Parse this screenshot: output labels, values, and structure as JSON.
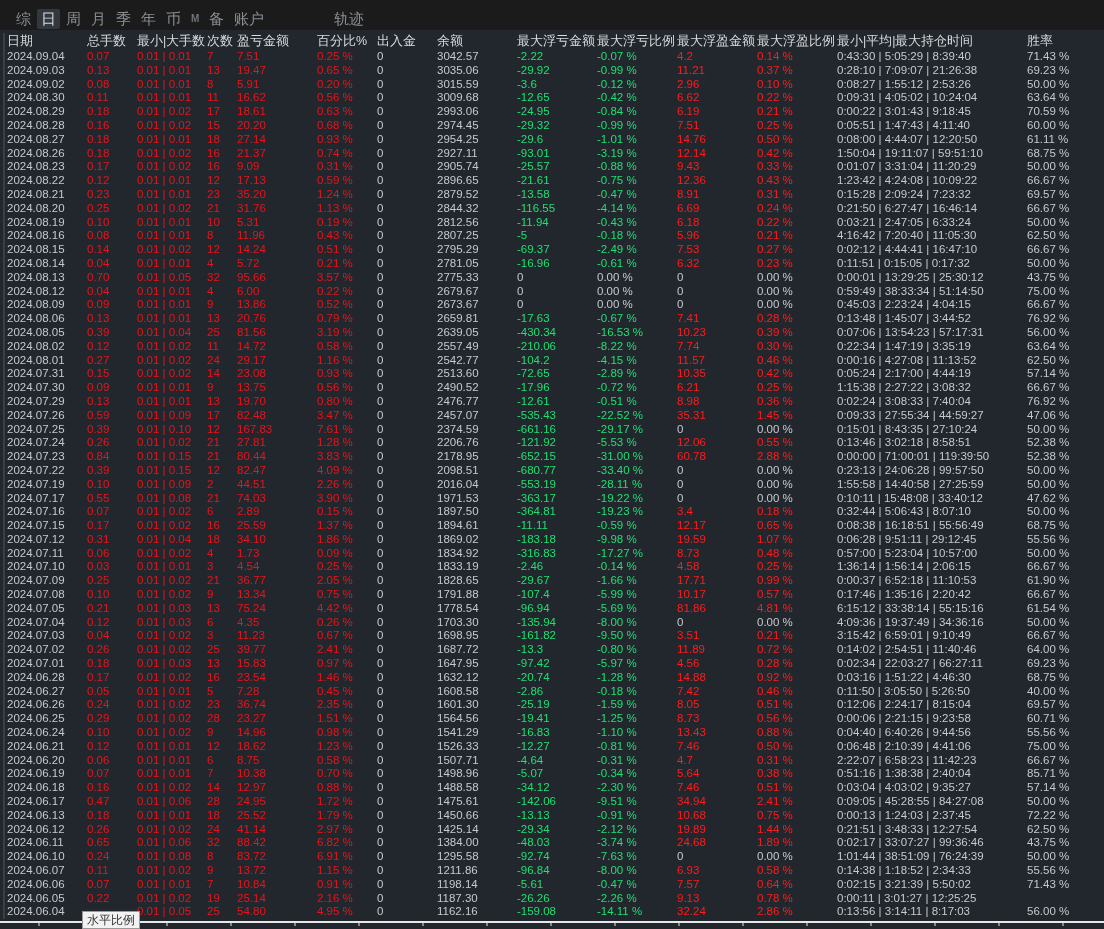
{
  "tabs": [
    {
      "label": "综",
      "selected": false
    },
    {
      "label": "日",
      "selected": true
    },
    {
      "label": "周",
      "selected": false
    },
    {
      "label": "月",
      "selected": false
    },
    {
      "label": "季",
      "selected": false
    },
    {
      "label": "年",
      "selected": false
    },
    {
      "label": "币",
      "selected": false
    },
    {
      "label": "M",
      "selected": false
    },
    {
      "label": "备",
      "selected": false
    },
    {
      "label": "账户",
      "selected": false
    },
    {
      "label": "轨迹",
      "selected": false
    }
  ],
  "table": {
    "columns": [
      {
        "label": "日期",
        "kind": "plain"
      },
      {
        "label": "总手数",
        "kind": "gain"
      },
      {
        "label": "最小|大手数",
        "kind": "gain"
      },
      {
        "label": "次数",
        "kind": "gain"
      },
      {
        "label": "盈亏金额",
        "kind": "gain"
      },
      {
        "label": "百分比%",
        "kind": "gain"
      },
      {
        "label": "出入金",
        "kind": "plain"
      },
      {
        "label": "余额",
        "kind": "plain"
      },
      {
        "label": "最大浮亏金额",
        "kind": "drawdown"
      },
      {
        "label": "最大浮亏比例",
        "kind": "drawdown"
      },
      {
        "label": "最大浮盈金额",
        "kind": "runup"
      },
      {
        "label": "最大浮盈比例",
        "kind": "runup"
      },
      {
        "label": "最小|平均|最大持仓时间",
        "kind": "plain"
      },
      {
        "label": "胜率",
        "kind": "plain"
      }
    ],
    "rows": [
      {
        "cells": [
          "2024.09.04",
          "0.07",
          "0.01 | 0.01",
          "7",
          "7.51",
          "0.25 %",
          "0",
          "3042.57",
          "-2.22",
          "-0.07 %",
          "4.2",
          "0.14 %",
          "0:43:30 | 5:05:29 | 8:39:40",
          "71.43 %"
        ],
        "loss_flat": false,
        "profit_flat": false
      },
      {
        "cells": [
          "2024.09.03",
          "0.13",
          "0.01 | 0.01",
          "13",
          "19.47",
          "0.65 %",
          "0",
          "3035.06",
          "-29.92",
          "-0.99 %",
          "11.21",
          "0.37 %",
          "0:28:10 | 7:09:07 | 21:26:38",
          "69.23 %"
        ],
        "loss_flat": false,
        "profit_flat": false
      },
      {
        "cells": [
          "2024.09.02",
          "0.08",
          "0.01 | 0.01",
          "8",
          "5.91",
          "0.20 %",
          "0",
          "3015.59",
          "-3.6",
          "-0.12 %",
          "2.96",
          "0.10 %",
          "0:08:27 | 1:55:12 | 2:53:26",
          "50.00 %"
        ],
        "loss_flat": false,
        "profit_flat": false
      },
      {
        "cells": [
          "2024.08.30",
          "0.11",
          "0.01 | 0.01",
          "11",
          "16.62",
          "0.56 %",
          "0",
          "3009.68",
          "-12.65",
          "-0.42 %",
          "6.62",
          "0.22 %",
          "0:09:31 | 4:05:02 | 10:24:04",
          "63.64 %"
        ],
        "loss_flat": false,
        "profit_flat": false
      },
      {
        "cells": [
          "2024.08.29",
          "0.18",
          "0.01 | 0.02",
          "17",
          "18.61",
          "0.63 %",
          "0",
          "2993.06",
          "-24.95",
          "-0.84 %",
          "6.19",
          "0.21 %",
          "0:00:22 | 3:01:43 | 9:18:45",
          "70.59 %"
        ],
        "loss_flat": false,
        "profit_flat": false
      },
      {
        "cells": [
          "2024.08.28",
          "0.16",
          "0.01 | 0.02",
          "15",
          "20.20",
          "0.68 %",
          "0",
          "2974.45",
          "-29.32",
          "-0.99 %",
          "7.51",
          "0.25 %",
          "0:05:51 | 1:47:43 | 4:11:40",
          "60.00 %"
        ],
        "loss_flat": false,
        "profit_flat": false
      },
      {
        "cells": [
          "2024.08.27",
          "0.18",
          "0.01 | 0.01",
          "18",
          "27.14",
          "0.93 %",
          "0",
          "2954.25",
          "-29.6",
          "-1.01 %",
          "14.76",
          "0.50 %",
          "0:08:00 | 4:44:07 | 12:20:50",
          "61.11 %"
        ],
        "loss_flat": false,
        "profit_flat": false
      },
      {
        "cells": [
          "2024.08.26",
          "0.18",
          "0.01 | 0.02",
          "16",
          "21.37",
          "0.74 %",
          "0",
          "2927.11",
          "-93.01",
          "-3.19 %",
          "12.14",
          "0.42 %",
          "1:50:04 | 19:11:07 | 59:51:10",
          "68.75 %"
        ],
        "loss_flat": false,
        "profit_flat": false
      },
      {
        "cells": [
          "2024.08.23",
          "0.17",
          "0.01 | 0.02",
          "16",
          "9.09",
          "0.31 %",
          "0",
          "2905.74",
          "-25.57",
          "-0.88 %",
          "9.43",
          "0.33 %",
          "0:01:07 | 3:31:04 | 11:20:29",
          "50.00 %"
        ],
        "loss_flat": false,
        "profit_flat": false
      },
      {
        "cells": [
          "2024.08.22",
          "0.12",
          "0.01 | 0.01",
          "12",
          "17.13",
          "0.59 %",
          "0",
          "2896.65",
          "-21.61",
          "-0.75 %",
          "12.36",
          "0.43 %",
          "1:23:42 | 4:24:08 | 10:09:22",
          "66.67 %"
        ],
        "loss_flat": false,
        "profit_flat": false
      },
      {
        "cells": [
          "2024.08.21",
          "0.23",
          "0.01 | 0.01",
          "23",
          "35.20",
          "1.24 %",
          "0",
          "2879.52",
          "-13.58",
          "-0.47 %",
          "8.91",
          "0.31 %",
          "0:15:28 | 2:09:24 | 7:23:32",
          "69.57 %"
        ],
        "loss_flat": false,
        "profit_flat": false
      },
      {
        "cells": [
          "2024.08.20",
          "0.25",
          "0.01 | 0.02",
          "21",
          "31.76",
          "1.13 %",
          "0",
          "2844.32",
          "-116.55",
          "-4.14 %",
          "6.69",
          "0.24 %",
          "0:21:50 | 6:27:47 | 16:46:14",
          "66.67 %"
        ],
        "loss_flat": false,
        "profit_flat": false
      },
      {
        "cells": [
          "2024.08.19",
          "0.10",
          "0.01 | 0.01",
          "10",
          "5.31",
          "0.19 %",
          "0",
          "2812.56",
          "-11.94",
          "-0.43 %",
          "6.18",
          "0.22 %",
          "0:03:21 | 2:47:05 | 6:33:24",
          "50.00 %"
        ],
        "loss_flat": false,
        "profit_flat": false
      },
      {
        "cells": [
          "2024.08.16",
          "0.08",
          "0.01 | 0.01",
          "8",
          "11.96",
          "0.43 %",
          "0",
          "2807.25",
          "-5",
          "-0.18 %",
          "5.96",
          "0.21 %",
          "4:16:42 | 7:20:40 | 11:05:30",
          "62.50 %"
        ],
        "loss_flat": false,
        "profit_flat": false
      },
      {
        "cells": [
          "2024.08.15",
          "0.14",
          "0.01 | 0.02",
          "12",
          "14.24",
          "0.51 %",
          "0",
          "2795.29",
          "-69.37",
          "-2.49 %",
          "7.53",
          "0.27 %",
          "0:02:12 | 4:44:41 | 16:47:10",
          "66.67 %"
        ],
        "loss_flat": false,
        "profit_flat": false
      },
      {
        "cells": [
          "2024.08.14",
          "0.04",
          "0.01 | 0.01",
          "4",
          "5.72",
          "0.21 %",
          "0",
          "2781.05",
          "-16.96",
          "-0.61 %",
          "6.32",
          "0.23 %",
          "0:11:51 | 0:15:05 | 0:17:32",
          "50.00 %"
        ],
        "loss_flat": false,
        "profit_flat": false
      },
      {
        "cells": [
          "2024.08.13",
          "0.70",
          "0.01 | 0.05",
          "32",
          "95.66",
          "3.57 %",
          "0",
          "2775.33",
          "0",
          "0.00 %",
          "0",
          "0.00 %",
          "0:00:01 | 13:29:25 | 25:30:12",
          "43.75 %"
        ],
        "loss_flat": true,
        "profit_flat": true
      },
      {
        "cells": [
          "2024.08.12",
          "0.04",
          "0.01 | 0.01",
          "4",
          "6.00",
          "0.22 %",
          "0",
          "2679.67",
          "0",
          "0.00 %",
          "0",
          "0.00 %",
          "0:59:49 | 38:33:34 | 51:14:50",
          "75.00 %"
        ],
        "loss_flat": true,
        "profit_flat": true
      },
      {
        "cells": [
          "2024.08.09",
          "0.09",
          "0.01 | 0.01",
          "9",
          "13.86",
          "0.52 %",
          "0",
          "2673.67",
          "0",
          "0.00 %",
          "0",
          "0.00 %",
          "0:45:03 | 2:23:24 | 4:04:15",
          "66.67 %"
        ],
        "loss_flat": true,
        "profit_flat": true
      },
      {
        "cells": [
          "2024.08.06",
          "0.13",
          "0.01 | 0.01",
          "13",
          "20.76",
          "0.79 %",
          "0",
          "2659.81",
          "-17.63",
          "-0.67 %",
          "7.41",
          "0.28 %",
          "0:13:48 | 1:45:07 | 3:44:52",
          "76.92 %"
        ],
        "loss_flat": false,
        "profit_flat": false
      },
      {
        "cells": [
          "2024.08.05",
          "0.39",
          "0.01 | 0.04",
          "25",
          "81.56",
          "3.19 %",
          "0",
          "2639.05",
          "-430.34",
          "-16.53 %",
          "10.23",
          "0.39 %",
          "0:07:06 | 13:54:23 | 57:17:31",
          "56.00 %"
        ],
        "loss_flat": false,
        "profit_flat": false
      },
      {
        "cells": [
          "2024.08.02",
          "0.12",
          "0.01 | 0.02",
          "11",
          "14.72",
          "0.58 %",
          "0",
          "2557.49",
          "-210.06",
          "-8.22 %",
          "7.74",
          "0.30 %",
          "0:22:34 | 1:47:19 | 3:35:19",
          "63.64 %"
        ],
        "loss_flat": false,
        "profit_flat": false
      },
      {
        "cells": [
          "2024.08.01",
          "0.27",
          "0.01 | 0.02",
          "24",
          "29.17",
          "1.16 %",
          "0",
          "2542.77",
          "-104.2",
          "-4.15 %",
          "11.57",
          "0.46 %",
          "0:00:16 | 4:27:08 | 11:13:52",
          "62.50 %"
        ],
        "loss_flat": false,
        "profit_flat": false
      },
      {
        "cells": [
          "2024.07.31",
          "0.15",
          "0.01 | 0.02",
          "14",
          "23.08",
          "0.93 %",
          "0",
          "2513.60",
          "-72.65",
          "-2.89 %",
          "10.35",
          "0.42 %",
          "0:05:24 | 2:17:00 | 4:44:19",
          "57.14 %"
        ],
        "loss_flat": false,
        "profit_flat": false
      },
      {
        "cells": [
          "2024.07.30",
          "0.09",
          "0.01 | 0.01",
          "9",
          "13.75",
          "0.56 %",
          "0",
          "2490.52",
          "-17.96",
          "-0.72 %",
          "6.21",
          "0.25 %",
          "1:15:38 | 2:27:22 | 3:08:32",
          "66.67 %"
        ],
        "loss_flat": false,
        "profit_flat": false
      },
      {
        "cells": [
          "2024.07.29",
          "0.13",
          "0.01 | 0.01",
          "13",
          "19.70",
          "0.80 %",
          "0",
          "2476.77",
          "-12.61",
          "-0.51 %",
          "8.98",
          "0.36 %",
          "0:02:24 | 3:08:33 | 7:40:04",
          "76.92 %"
        ],
        "loss_flat": false,
        "profit_flat": false
      },
      {
        "cells": [
          "2024.07.26",
          "0.59",
          "0.01 | 0.09",
          "17",
          "82.48",
          "3.47 %",
          "0",
          "2457.07",
          "-535.43",
          "-22.52 %",
          "35.31",
          "1.45 %",
          "0:09:33 | 27:55:34 | 44:59:27",
          "47.06 %"
        ],
        "loss_flat": false,
        "profit_flat": false
      },
      {
        "cells": [
          "2024.07.25",
          "0.39",
          "0.01 | 0.10",
          "12",
          "167.83",
          "7.61 %",
          "0",
          "2374.59",
          "-661.16",
          "-29.17 %",
          "0",
          "0.00 %",
          "0:15:01 | 8:43:35 | 27:10:24",
          "50.00 %"
        ],
        "loss_flat": false,
        "profit_flat": true
      },
      {
        "cells": [
          "2024.07.24",
          "0.26",
          "0.01 | 0.02",
          "21",
          "27.81",
          "1.28 %",
          "0",
          "2206.76",
          "-121.92",
          "-5.53 %",
          "12.06",
          "0.55 %",
          "0:13:46 | 3:02:18 | 8:58:51",
          "52.38 %"
        ],
        "loss_flat": false,
        "profit_flat": false
      },
      {
        "cells": [
          "2024.07.23",
          "0.84",
          "0.01 | 0.15",
          "21",
          "80.44",
          "3.83 %",
          "0",
          "2178.95",
          "-652.15",
          "-31.00 %",
          "60.78",
          "2.88 %",
          "0:00:00 | 71:00:01 | 119:39:50",
          "52.38 %"
        ],
        "loss_flat": false,
        "profit_flat": false
      },
      {
        "cells": [
          "2024.07.22",
          "0.39",
          "0.01 | 0.15",
          "12",
          "82.47",
          "4.09 %",
          "0",
          "2098.51",
          "-680.77",
          "-33.40 %",
          "0",
          "0.00 %",
          "0:23:13 | 24:06:28 | 99:57:50",
          "50.00 %"
        ],
        "loss_flat": false,
        "profit_flat": true
      },
      {
        "cells": [
          "2024.07.19",
          "0.10",
          "0.01 | 0.09",
          "2",
          "44.51",
          "2.26 %",
          "0",
          "2016.04",
          "-553.19",
          "-28.11 %",
          "0",
          "0.00 %",
          "1:55:58 | 14:40:58 | 27:25:59",
          "50.00 %"
        ],
        "loss_flat": false,
        "profit_flat": true
      },
      {
        "cells": [
          "2024.07.17",
          "0.55",
          "0.01 | 0.08",
          "21",
          "74.03",
          "3.90 %",
          "0",
          "1971.53",
          "-363.17",
          "-19.22 %",
          "0",
          "0.00 %",
          "0:10:11 | 15:48:08 | 33:40:12",
          "47.62 %"
        ],
        "loss_flat": false,
        "profit_flat": true
      },
      {
        "cells": [
          "2024.07.16",
          "0.07",
          "0.01 | 0.02",
          "6",
          "2.89",
          "0.15 %",
          "0",
          "1897.50",
          "-364.81",
          "-19.23 %",
          "3.4",
          "0.18 %",
          "0:32:44 | 5:06:43 | 8:07:10",
          "50.00 %"
        ],
        "loss_flat": false,
        "profit_flat": false
      },
      {
        "cells": [
          "2024.07.15",
          "0.17",
          "0.01 | 0.02",
          "16",
          "25.59",
          "1.37 %",
          "0",
          "1894.61",
          "-11.11",
          "-0.59 %",
          "12.17",
          "0.65 %",
          "0:08:38 | 16:18:51 | 55:56:49",
          "68.75 %"
        ],
        "loss_flat": false,
        "profit_flat": false
      },
      {
        "cells": [
          "2024.07.12",
          "0.31",
          "0.01 | 0.04",
          "18",
          "34.10",
          "1.86 %",
          "0",
          "1869.02",
          "-183.18",
          "-9.98 %",
          "19.59",
          "1.07 %",
          "0:06:28 | 9:51:11 | 29:12:45",
          "55.56 %"
        ],
        "loss_flat": false,
        "profit_flat": false
      },
      {
        "cells": [
          "2024.07.11",
          "0.06",
          "0.01 | 0.02",
          "4",
          "1.73",
          "0.09 %",
          "0",
          "1834.92",
          "-316.83",
          "-17.27 %",
          "8.73",
          "0.48 %",
          "0:57:00 | 5:23:04 | 10:57:00",
          "50.00 %"
        ],
        "loss_flat": false,
        "profit_flat": false
      },
      {
        "cells": [
          "2024.07.10",
          "0.03",
          "0.01 | 0.01",
          "3",
          "4.54",
          "0.25 %",
          "0",
          "1833.19",
          "-2.46",
          "-0.14 %",
          "4.58",
          "0.25 %",
          "1:36:14 | 1:56:14 | 2:06:15",
          "66.67 %"
        ],
        "loss_flat": false,
        "profit_flat": false
      },
      {
        "cells": [
          "2024.07.09",
          "0.25",
          "0.01 | 0.02",
          "21",
          "36.77",
          "2.05 %",
          "0",
          "1828.65",
          "-29.67",
          "-1.66 %",
          "17.71",
          "0.99 %",
          "0:00:37 | 6:52:18 | 11:10:53",
          "61.90 %"
        ],
        "loss_flat": false,
        "profit_flat": false
      },
      {
        "cells": [
          "2024.07.08",
          "0.10",
          "0.01 | 0.02",
          "9",
          "13.34",
          "0.75 %",
          "0",
          "1791.88",
          "-107.4",
          "-5.99 %",
          "10.17",
          "0.57 %",
          "0:17:46 | 1:35:16 | 2:20:42",
          "66.67 %"
        ],
        "loss_flat": false,
        "profit_flat": false
      },
      {
        "cells": [
          "2024.07.05",
          "0.21",
          "0.01 | 0.03",
          "13",
          "75.24",
          "4.42 %",
          "0",
          "1778.54",
          "-96.94",
          "-5.69 %",
          "81.86",
          "4.81 %",
          "6:15:12 | 33:38:14 | 55:15:16",
          "61.54 %"
        ],
        "loss_flat": false,
        "profit_flat": false
      },
      {
        "cells": [
          "2024.07.04",
          "0.12",
          "0.01 | 0.03",
          "6",
          "4.35",
          "0.26 %",
          "0",
          "1703.30",
          "-135.94",
          "-8.00 %",
          "0",
          "0.00 %",
          "4:09:36 | 19:37:49 | 34:36:16",
          "50.00 %"
        ],
        "loss_flat": false,
        "profit_flat": true
      },
      {
        "cells": [
          "2024.07.03",
          "0.04",
          "0.01 | 0.02",
          "3",
          "11.23",
          "0.67 %",
          "0",
          "1698.95",
          "-161.82",
          "-9.50 %",
          "3.51",
          "0.21 %",
          "3:15:42 | 6:59:01 | 9:10:49",
          "66.67 %"
        ],
        "loss_flat": false,
        "profit_flat": false
      },
      {
        "cells": [
          "2024.07.02",
          "0.26",
          "0.01 | 0.02",
          "25",
          "39.77",
          "2.41 %",
          "0",
          "1687.72",
          "-13.3",
          "-0.80 %",
          "11.89",
          "0.72 %",
          "0:14:02 | 2:54:51 | 11:40:46",
          "64.00 %"
        ],
        "loss_flat": false,
        "profit_flat": false
      },
      {
        "cells": [
          "2024.07.01",
          "0.18",
          "0.01 | 0.03",
          "13",
          "15.83",
          "0.97 %",
          "0",
          "1647.95",
          "-97.42",
          "-5.97 %",
          "4.56",
          "0.28 %",
          "0:02:34 | 22:03:27 | 66:27:11",
          "69.23 %"
        ],
        "loss_flat": false,
        "profit_flat": false
      },
      {
        "cells": [
          "2024.06.28",
          "0.17",
          "0.01 | 0.02",
          "16",
          "23.54",
          "1.46 %",
          "0",
          "1632.12",
          "-20.74",
          "-1.28 %",
          "14.88",
          "0.92 %",
          "0:03:16 | 1:51:22 | 4:46:30",
          "68.75 %"
        ],
        "loss_flat": false,
        "profit_flat": false
      },
      {
        "cells": [
          "2024.06.27",
          "0.05",
          "0.01 | 0.01",
          "5",
          "7.28",
          "0.45 %",
          "0",
          "1608.58",
          "-2.86",
          "-0.18 %",
          "7.42",
          "0.46 %",
          "0:11:50 | 3:05:50 | 5:26:50",
          "40.00 %"
        ],
        "loss_flat": false,
        "profit_flat": false
      },
      {
        "cells": [
          "2024.06.26",
          "0.24",
          "0.01 | 0.02",
          "23",
          "36.74",
          "2.35 %",
          "0",
          "1601.30",
          "-25.19",
          "-1.59 %",
          "8.05",
          "0.51 %",
          "0:12:06 | 2:24:17 | 8:15:04",
          "69.57 %"
        ],
        "loss_flat": false,
        "profit_flat": false
      },
      {
        "cells": [
          "2024.06.25",
          "0.29",
          "0.01 | 0.02",
          "28",
          "23.27",
          "1.51 %",
          "0",
          "1564.56",
          "-19.41",
          "-1.25 %",
          "8.73",
          "0.56 %",
          "0:00:06 | 2:21:15 | 9:23:58",
          "60.71 %"
        ],
        "loss_flat": false,
        "profit_flat": false
      },
      {
        "cells": [
          "2024.06.24",
          "0.10",
          "0.01 | 0.02",
          "9",
          "14.96",
          "0.98 %",
          "0",
          "1541.29",
          "-16.83",
          "-1.10 %",
          "13.43",
          "0.88 %",
          "0:04:40 | 6:40:26 | 9:44:56",
          "55.56 %"
        ],
        "loss_flat": false,
        "profit_flat": false
      },
      {
        "cells": [
          "2024.06.21",
          "0.12",
          "0.01 | 0.01",
          "12",
          "18.62",
          "1.23 %",
          "0",
          "1526.33",
          "-12.27",
          "-0.81 %",
          "7.46",
          "0.50 %",
          "0:06:48 | 2:10:39 | 4:41:06",
          "75.00 %"
        ],
        "loss_flat": false,
        "profit_flat": false
      },
      {
        "cells": [
          "2024.06.20",
          "0.06",
          "0.01 | 0.01",
          "6",
          "8.75",
          "0.58 %",
          "0",
          "1507.71",
          "-4.64",
          "-0.31 %",
          "4.7",
          "0.31 %",
          "2:22:07 | 6:58:23 | 11:42:23",
          "66.67 %"
        ],
        "loss_flat": false,
        "profit_flat": false
      },
      {
        "cells": [
          "2024.06.19",
          "0.07",
          "0.01 | 0.01",
          "7",
          "10.38",
          "0.70 %",
          "0",
          "1498.96",
          "-5.07",
          "-0.34 %",
          "5.64",
          "0.38 %",
          "0:51:16 | 1:38:38 | 2:40:04",
          "85.71 %"
        ],
        "loss_flat": false,
        "profit_flat": false
      },
      {
        "cells": [
          "2024.06.18",
          "0.16",
          "0.01 | 0.02",
          "14",
          "12.97",
          "0.88 %",
          "0",
          "1488.58",
          "-34.12",
          "-2.30 %",
          "7.46",
          "0.51 %",
          "0:03:04 | 4:03:02 | 9:35:27",
          "57.14 %"
        ],
        "loss_flat": false,
        "profit_flat": false
      },
      {
        "cells": [
          "2024.06.17",
          "0.47",
          "0.01 | 0.06",
          "28",
          "24.95",
          "1.72 %",
          "0",
          "1475.61",
          "-142.06",
          "-9.51 %",
          "34.94",
          "2.41 %",
          "0:09:05 | 45:28:55 | 84:27:08",
          "50.00 %"
        ],
        "loss_flat": false,
        "profit_flat": false
      },
      {
        "cells": [
          "2024.06.13",
          "0.18",
          "0.01 | 0.01",
          "18",
          "25.52",
          "1.79 %",
          "0",
          "1450.66",
          "-13.13",
          "-0.91 %",
          "10.68",
          "0.75 %",
          "0:00:13 | 1:24:03 | 2:37:45",
          "72.22 %"
        ],
        "loss_flat": false,
        "profit_flat": false
      },
      {
        "cells": [
          "2024.06.12",
          "0.26",
          "0.01 | 0.02",
          "24",
          "41.14",
          "2.97 %",
          "0",
          "1425.14",
          "-29.34",
          "-2.12 %",
          "19.89",
          "1.44 %",
          "0:21:51 | 3:48:33 | 12:27:54",
          "62.50 %"
        ],
        "loss_flat": false,
        "profit_flat": false
      },
      {
        "cells": [
          "2024.06.11",
          "0.65",
          "0.01 | 0.06",
          "32",
          "88.42",
          "6.82 %",
          "0",
          "1384.00",
          "-48.03",
          "-3.74 %",
          "24.68",
          "1.89 %",
          "0:02:17 | 33:07:27 | 99:36:46",
          "43.75 %"
        ],
        "loss_flat": false,
        "profit_flat": false
      },
      {
        "cells": [
          "2024.06.10",
          "0.24",
          "0.01 | 0.08",
          "8",
          "83.72",
          "6.91 %",
          "0",
          "1295.58",
          "-92.74",
          "-7.63 %",
          "0",
          "0.00 %",
          "1:01:44 | 38:51:09 | 76:24:39",
          "50.00 %"
        ],
        "loss_flat": false,
        "profit_flat": true
      },
      {
        "cells": [
          "2024.06.07",
          "0.11",
          "0.01 | 0.02",
          "9",
          "13.72",
          "1.15 %",
          "0",
          "1211.86",
          "-96.84",
          "-8.00 %",
          "6.93",
          "0.58 %",
          "0:14:38 | 1:18:52 | 2:34:33",
          "55.56 %"
        ],
        "loss_flat": false,
        "profit_flat": false
      },
      {
        "cells": [
          "2024.06.06",
          "0.07",
          "0.01 | 0.01",
          "7",
          "10.84",
          "0.91 %",
          "0",
          "1198.14",
          "-5.61",
          "-0.47 %",
          "7.57",
          "0.64 %",
          "0:02:15 | 3:21:39 | 5:50:02",
          "71.43 %"
        ],
        "loss_flat": false,
        "profit_flat": false
      },
      {
        "cells": [
          "2024.06.05",
          "0.22",
          "0.01 | 0.02",
          "19",
          "25.14",
          "2.16 %",
          "0",
          "1187.30",
          "-26.26",
          "-2.26 %",
          "9.13",
          "0.78 %",
          "0:00:11 | 3:01:27 | 12:25:25",
          null
        ],
        "loss_flat": false,
        "profit_flat": false
      },
      {
        "cells": [
          "2024.06.04",
          null,
          "0.01 | 0.05",
          "25",
          "54.80",
          "4.95 %",
          "0",
          "1162.16",
          "-159.08",
          "-14.11 %",
          "32.24",
          "2.86 %",
          "0:13:56 | 3:14:11 | 8:17:03",
          "56.00 %"
        ],
        "loss_flat": false,
        "profit_flat": false
      }
    ]
  },
  "tooltip": {
    "text": "水平比例"
  }
}
